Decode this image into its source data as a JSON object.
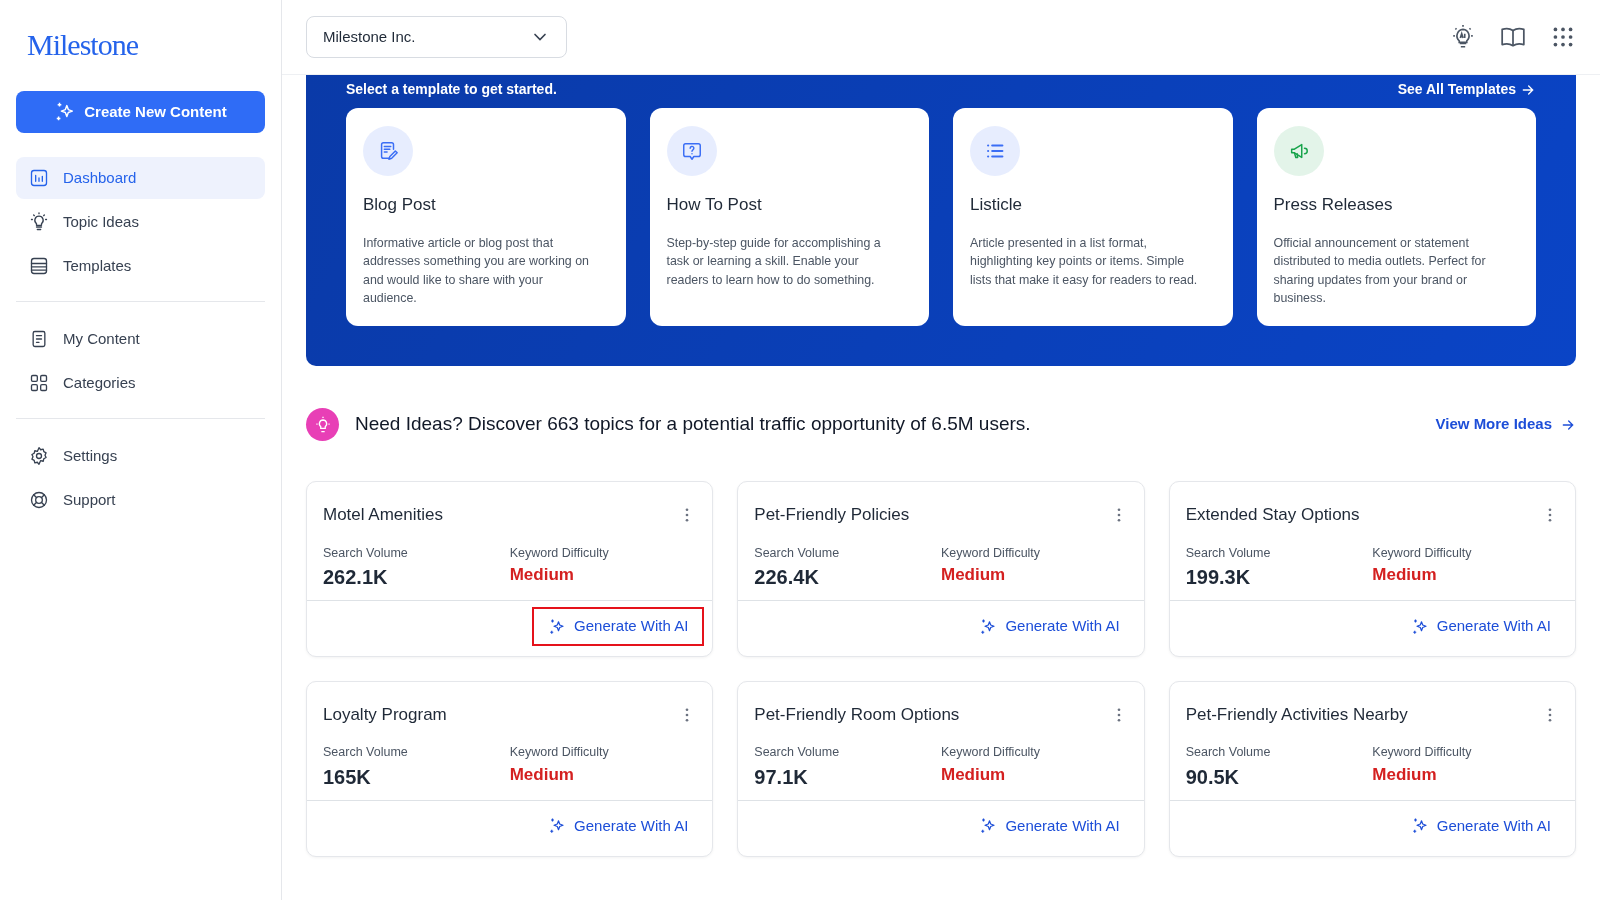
{
  "logo": "Milestone",
  "create_button": "Create New Content",
  "sidebar": {
    "groups": [
      [
        {
          "label": "Dashboard",
          "selected": true
        },
        {
          "label": "Topic Ideas",
          "selected": false
        },
        {
          "label": "Templates",
          "selected": false
        }
      ],
      [
        {
          "label": "My Content",
          "selected": false
        },
        {
          "label": "Categories",
          "selected": false
        }
      ],
      [
        {
          "label": "Settings",
          "selected": false
        },
        {
          "label": "Support",
          "selected": false
        }
      ]
    ]
  },
  "header": {
    "organization": "Milestone Inc."
  },
  "templates": {
    "subtitle": "Select a template to get started.",
    "see_all": "See All Templates",
    "cards": [
      {
        "title": "Blog Post",
        "description": "Informative article or blog post that addresses something you are working on and would like to share with your audience."
      },
      {
        "title": "How To Post",
        "description": "Step-by-step guide for accomplishing a task or learning a skill. Enable your readers to learn how to do something."
      },
      {
        "title": "Listicle",
        "description": "Article presented in a list format, highlighting key points or items. Simple lists that make it easy for readers to read."
      },
      {
        "title": "Press Releases",
        "description": "Official announcement or statement distributed to media outlets. Perfect for sharing updates from your brand or business."
      }
    ]
  },
  "ideas": {
    "message": "Need Ideas? Discover 663 topics for a potential traffic opportunity of 6.5M users.",
    "link": "View More Ideas"
  },
  "topics": [
    {
      "title": "Motel Amenities",
      "volume_label": "Search Volume",
      "volume": "262.1K",
      "difficulty_label": "Keyword Difficulty",
      "difficulty": "Medium",
      "action": "Generate With AI",
      "highlighted": true
    },
    {
      "title": "Pet-Friendly Policies",
      "volume_label": "Search Volume",
      "volume": "226.4K",
      "difficulty_label": "Keyword Difficulty",
      "difficulty": "Medium",
      "action": "Generate With AI",
      "highlighted": false
    },
    {
      "title": "Extended Stay Options",
      "volume_label": "Search Volume",
      "volume": "199.3K",
      "difficulty_label": "Keyword Difficulty",
      "difficulty": "Medium",
      "action": "Generate With AI",
      "highlighted": false
    },
    {
      "title": "Loyalty Program",
      "volume_label": "Search Volume",
      "volume": "165K",
      "difficulty_label": "Keyword Difficulty",
      "difficulty": "Medium",
      "action": "Generate With AI",
      "highlighted": false
    },
    {
      "title": "Pet-Friendly Room Options",
      "volume_label": "Search Volume",
      "volume": "97.1K",
      "difficulty_label": "Keyword Difficulty",
      "difficulty": "Medium",
      "action": "Generate With AI",
      "highlighted": false
    },
    {
      "title": "Pet-Friendly Activities Nearby",
      "volume_label": "Search Volume",
      "volume": "90.5K",
      "difficulty_label": "Keyword Difficulty",
      "difficulty": "Medium",
      "action": "Generate With AI",
      "highlighted": false
    }
  ]
}
